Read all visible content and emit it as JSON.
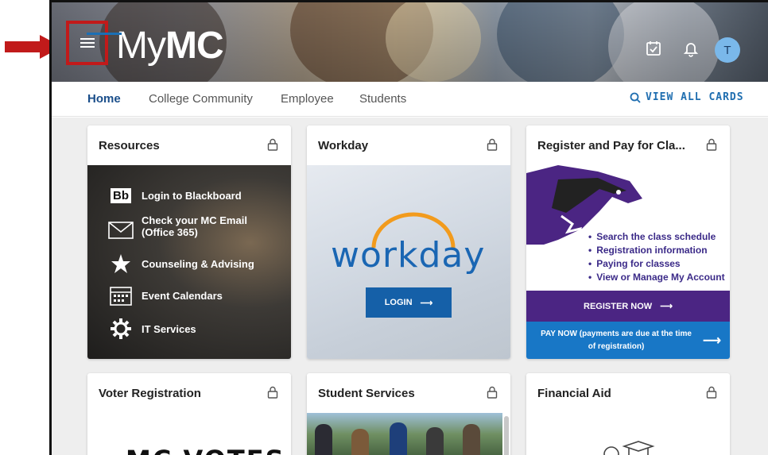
{
  "header": {
    "logo_prefix": "My",
    "logo_suffix": "MC",
    "avatar_initial": "T",
    "icons": [
      "menu-icon",
      "calendar-icon",
      "bell-icon"
    ]
  },
  "tabs": {
    "items": [
      "Home",
      "College Community",
      "Employee",
      "Students"
    ],
    "active": "Home",
    "view_all": "VIEW ALL CARDS"
  },
  "cards": {
    "resources": {
      "title": "Resources",
      "links": [
        {
          "label": "Login to Blackboard",
          "icon": "blackboard-icon"
        },
        {
          "label": "Check your MC Email",
          "sub": "(Office 365)",
          "icon": "envelope-icon"
        },
        {
          "label": "Counseling & Advising",
          "icon": "star-icon"
        },
        {
          "label": "Event Calendars",
          "icon": "calendar-icon"
        },
        {
          "label": "IT Services",
          "icon": "gear-icon"
        }
      ]
    },
    "workday": {
      "title": "Workday",
      "logo_text": "workday",
      "login_label": "LOGIN"
    },
    "register": {
      "title": "Register and Pay for Cla...",
      "bullets": [
        "Search the class schedule",
        "Registration information",
        "Paying for classes",
        "View or Manage My Account"
      ],
      "register_label": "REGISTER NOW",
      "pay_label": "PAY NOW (payments are due at the time of registration)"
    },
    "voter": {
      "title": "Voter Registration",
      "logo_text": "MC VOTES"
    },
    "student_services": {
      "title": "Student Services"
    },
    "financial_aid": {
      "title": "Financial Aid"
    }
  },
  "colors": {
    "annotation": "#c11a1a",
    "tab_active": "#1a4e8a",
    "link_blue": "#1f6eb0",
    "register_purple": "#4b2583",
    "pay_blue": "#1877c6"
  }
}
